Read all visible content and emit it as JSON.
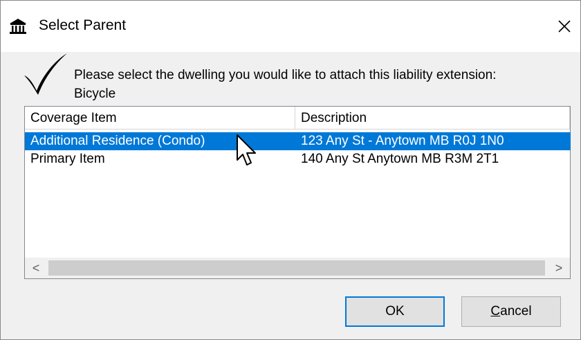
{
  "window": {
    "title": "Select Parent",
    "close_symbol": "✕"
  },
  "prompt": {
    "line1": "Please select the dwelling you would like to attach this liability extension:",
    "line2": "Bicycle"
  },
  "list": {
    "columns": [
      "Coverage Item",
      "Description"
    ],
    "rows": [
      {
        "coverage": "Additional Residence (Condo)",
        "description": "123 Any St - Anytown MB R0J 1N0",
        "selected": true
      },
      {
        "coverage": "Primary Item",
        "description": "140 Any St Anytown MB R3M 2T1",
        "selected": false
      }
    ]
  },
  "scrollbar": {
    "left": "<",
    "right": ">"
  },
  "buttons": {
    "ok": "OK",
    "cancel_mnemonic": "C",
    "cancel_rest": "ancel"
  },
  "colors": {
    "selection": "#0078d7",
    "default_button_border": "#0078d7"
  },
  "icons": [
    "bank-icon",
    "checkmark-icon",
    "close-icon",
    "mouse-pointer-icon"
  ]
}
